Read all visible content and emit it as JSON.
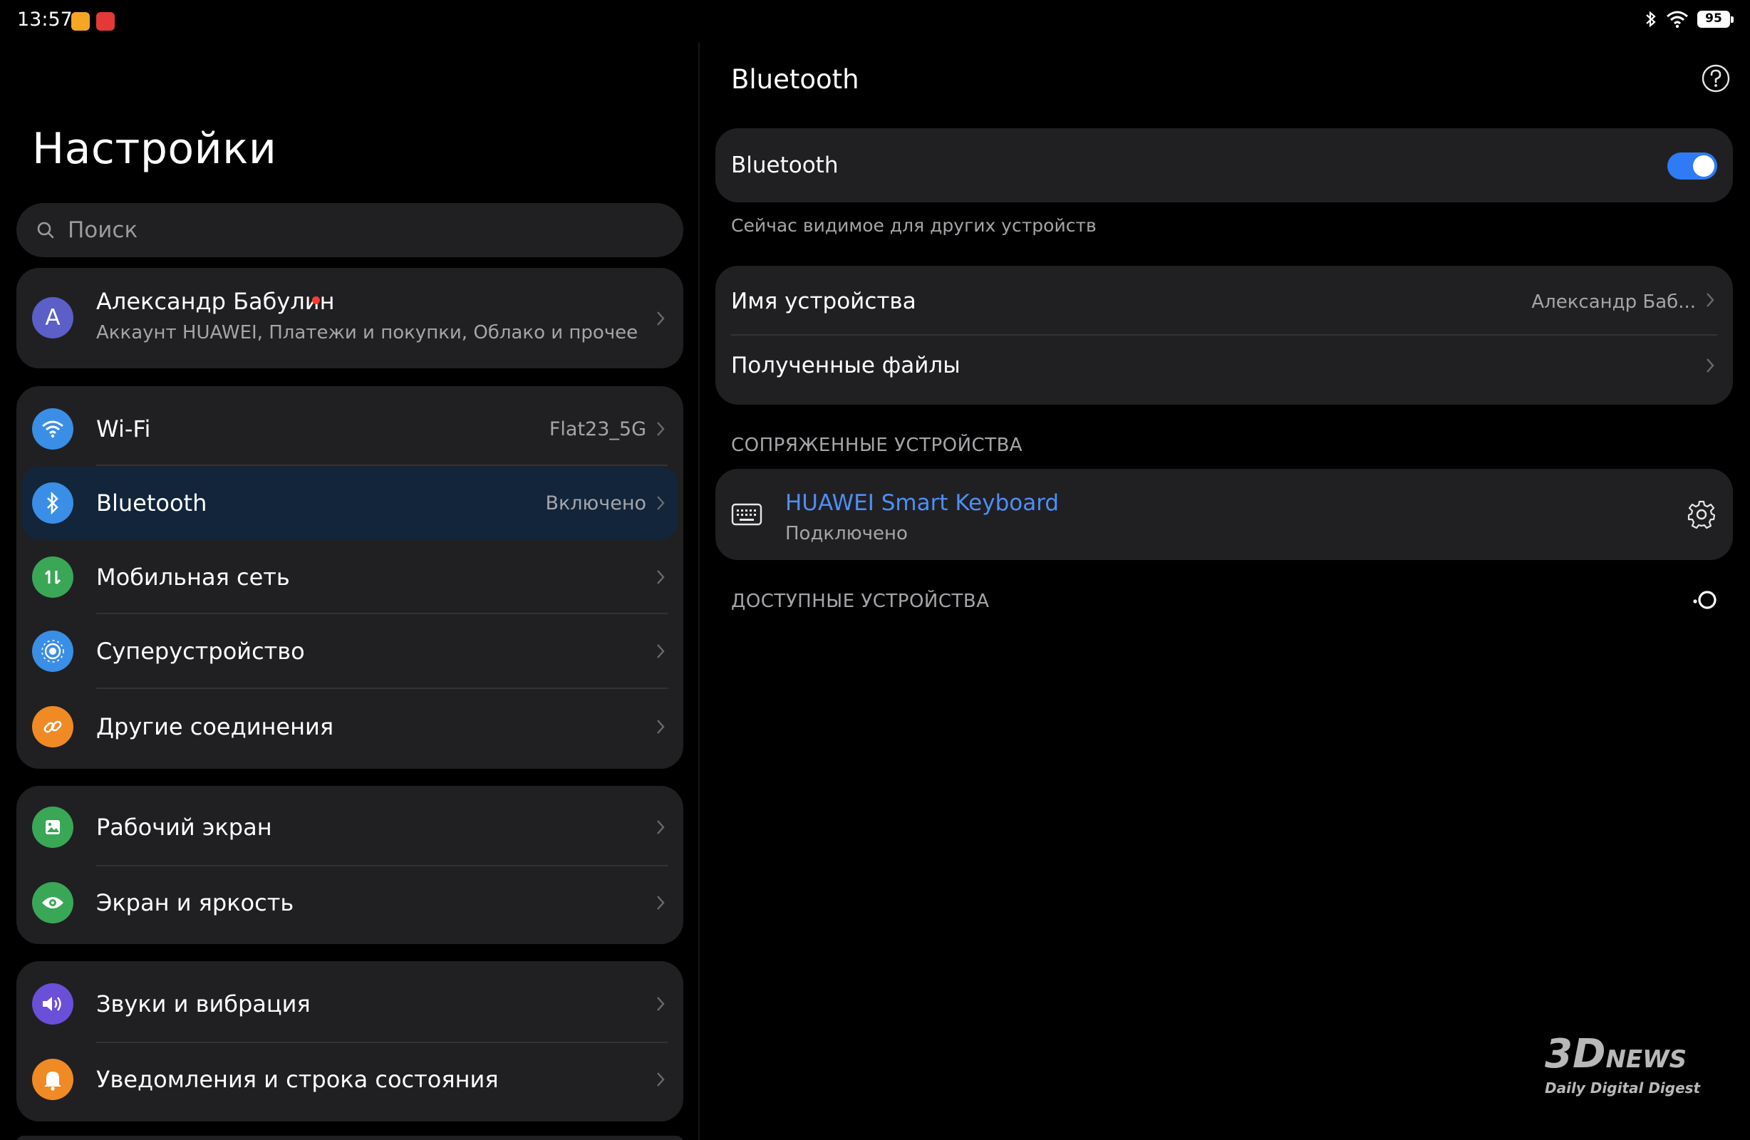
{
  "status_bar": {
    "time": "13:57",
    "battery": "95"
  },
  "left": {
    "title": "Настройки",
    "search_placeholder": "Поиск",
    "account": {
      "initial": "A",
      "name": "Александр Бабулин",
      "subtitle": "Аккаунт HUAWEI, Платежи и покупки, Облако и прочее"
    },
    "groups": [
      {
        "items": [
          {
            "label": "Wi-Fi",
            "value": "Flat23_5G",
            "icon": "wifi-icon",
            "color": "#3a8ee6"
          },
          {
            "label": "Bluetooth",
            "value": "Включено",
            "icon": "bluetooth-icon",
            "color": "#3a8ee6",
            "selected": true
          },
          {
            "label": "Мобильная сеть",
            "value": "",
            "icon": "mobile-data-icon",
            "color": "#3aa757"
          },
          {
            "label": "Суперустройство",
            "value": "",
            "icon": "super-device-icon",
            "color": "#3a8ee6"
          },
          {
            "label": "Другие соединения",
            "value": "",
            "icon": "link-icon",
            "color": "#f08a24"
          }
        ]
      },
      {
        "items": [
          {
            "label": "Рабочий экран",
            "value": "",
            "icon": "home-screen-icon",
            "color": "#3aa757"
          },
          {
            "label": "Экран и яркость",
            "value": "",
            "icon": "eye-icon",
            "color": "#3aa757"
          }
        ]
      },
      {
        "items": [
          {
            "label": "Звуки и вибрация",
            "value": "",
            "icon": "sound-icon",
            "color": "#6a4fd8"
          },
          {
            "label": "Уведомления и строка состояния",
            "value": "",
            "icon": "bell-icon",
            "color": "#f08a24"
          }
        ]
      }
    ]
  },
  "right": {
    "title": "Bluetooth",
    "toggle_label": "Bluetooth",
    "toggle_on": true,
    "visibility_hint": "Сейчас видимое для других устройств",
    "device_name_label": "Имя устройства",
    "device_name_value": "Александр Баб...",
    "received_files_label": "Полученные файлы",
    "paired_section": "СОПРЯЖЕННЫЕ УСТРОЙСТВА",
    "paired_device": {
      "name": "HUAWEI Smart Keyboard",
      "status": "Подключено"
    },
    "available_section": "ДОСТУПНЫЕ УСТРОЙСТВА"
  },
  "watermark": {
    "logo": "3D",
    "logo_suffix": "NEWS",
    "tagline": "Daily Digital Digest"
  },
  "colors": {
    "accent": "#2f7bf5",
    "link": "#4e8ef7",
    "card": "#202022",
    "selected": "#12253a"
  }
}
